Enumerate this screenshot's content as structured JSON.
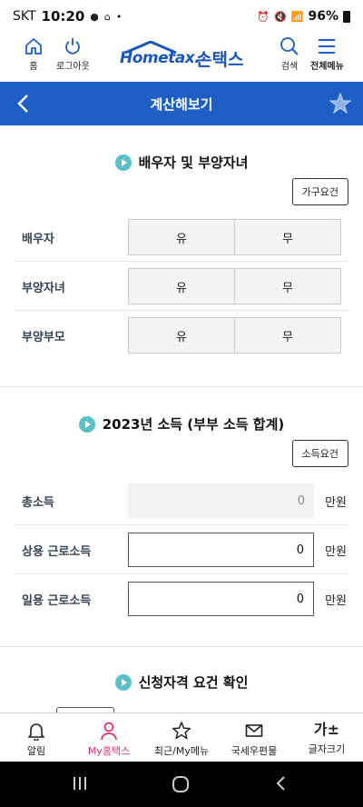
{
  "status_bar": {
    "carrier": "SKT",
    "time": "10:20",
    "battery": "96%"
  },
  "header": {
    "home_label": "홈",
    "logout_label": "로그아웃",
    "logo_text": "Hometax.",
    "logo_korean": "손택스",
    "search_label": "검색",
    "menu_label": "전체메뉴"
  },
  "titlebar": {
    "title": "계산해보기"
  },
  "spouse_section": {
    "title": "배우자 및 부양자녀",
    "requirement_button": "가구요건",
    "rows": [
      {
        "label": "배우자",
        "yes": "유",
        "no": "무"
      },
      {
        "label": "부양자녀",
        "yes": "유",
        "no": "무"
      },
      {
        "label": "부양부모",
        "yes": "유",
        "no": "무"
      }
    ]
  },
  "income_section": {
    "title": "2023년 소득 (부부 소득 합계)",
    "requirement_button": "소득요건",
    "rows": [
      {
        "label": "총소득",
        "value": "0",
        "unit": "만원"
      },
      {
        "label": "상용 근로소득",
        "value": "0",
        "unit": "만원"
      },
      {
        "label": "일용 근로소득",
        "value": "0",
        "unit": "만원"
      }
    ]
  },
  "eligibility_section": {
    "title": "신청자격 요건 확인"
  },
  "bottom_nav": {
    "items": [
      {
        "label": "알림",
        "icon": "bell-icon"
      },
      {
        "label": "My홈택스",
        "icon": "person-icon"
      },
      {
        "label": "최근/My메뉴",
        "icon": "star-icon"
      },
      {
        "label": "국세우편물",
        "icon": "envelope-icon"
      },
      {
        "label": "글자크기",
        "icon": "font-size-icon",
        "glyph": "가±"
      }
    ]
  },
  "colors": {
    "primary_blue": "#1d5fc5",
    "accent_teal": "#5bbfc7",
    "active_pink": "#d8336b"
  }
}
